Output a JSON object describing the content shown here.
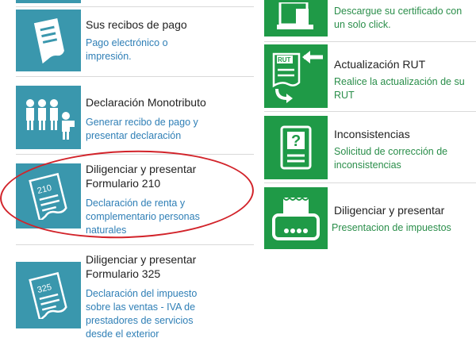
{
  "left": {
    "items": [
      {
        "title": "Sus recibos de pago",
        "desc": "Pago electrónico o impresión.",
        "icon": "receipt-icon"
      },
      {
        "title": "Declaración Monotributo",
        "desc": "Generar recibo de pago y presentar declaración",
        "icon": "people-icon"
      },
      {
        "title": "Diligenciar y presentar Formulario 210",
        "desc": "Declaración de renta y complementario personas naturales",
        "icon": "form-210-icon",
        "badge": "210"
      },
      {
        "title": "Diligenciar y presentar Formulario 325",
        "desc": "Declaración del impuesto sobre las ventas - IVA de prestadores de servicios desde el exterior",
        "icon": "form-325-icon",
        "badge": "325"
      }
    ]
  },
  "right": {
    "items": [
      {
        "title": "",
        "desc": "Descargue su certificado con un solo click.",
        "icon": "certificate-icon"
      },
      {
        "title": "Actualización RUT",
        "desc": "Realice la actualización de su RUT",
        "icon": "rut-update-icon",
        "badge": "RUT"
      },
      {
        "title": "Inconsistencias",
        "desc": "Solicitud de corrección de inconsistencias",
        "icon": "question-document-icon"
      },
      {
        "title": "Diligenciar y presentar",
        "desc": "Presentacion de impuestos",
        "icon": "tax-machine-icon"
      }
    ]
  },
  "colors": {
    "teal": "#3a97ad",
    "green": "#1f9a47",
    "highlight": "#d2232a"
  }
}
